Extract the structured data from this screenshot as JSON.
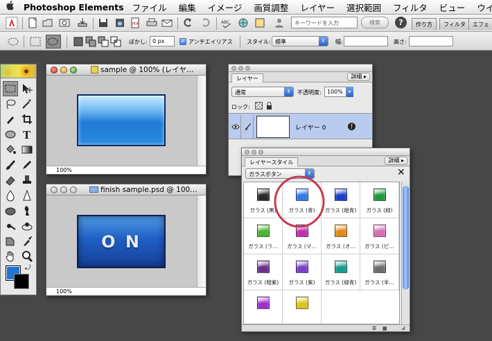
{
  "menubar": {
    "app_name": "Photoshop Elements",
    "menus": [
      "ファイル",
      "編集",
      "イメージ",
      "画質調整",
      "レイヤー",
      "選択範囲",
      "フィルタ",
      "ビュー",
      "ウイ"
    ]
  },
  "toolbar": {
    "search_placeholder": "キーワードを入力",
    "search_button": "検索",
    "help_label": "?",
    "palette_tabs": [
      "作り方",
      "フィルタ",
      "エフェ"
    ]
  },
  "options_bar": {
    "feather_label": "ぼかし:",
    "feather_value": "0 px",
    "antialias_label": "アンチエイリアス",
    "antialias_checked": true,
    "style_label": "スタイル:",
    "style_value": "標準",
    "width_label": "幅:",
    "height_label": "高さ:"
  },
  "windows": {
    "sample": {
      "title": "sample @ 100% (レイヤ…",
      "zoom": "100%"
    },
    "finish": {
      "title": "finish sample.psd @ 100…",
      "zoom": "100%",
      "button_text": "O N"
    }
  },
  "layers_panel": {
    "tab": "レイヤー",
    "more": "詳細 ▸",
    "blend_mode": "通常",
    "opacity_label": "不透明度:",
    "opacity_value": "100%",
    "lock_label": "ロック:",
    "layer_name": "レイヤー 0"
  },
  "styles_panel": {
    "tab": "レイヤースタイル",
    "more": "詳細 ▸",
    "category": "ガラスボタン",
    "close_label": "✕",
    "selected_index": 1,
    "items": [
      {
        "label": "ガラス (黒)",
        "color": "#2a2a2a"
      },
      {
        "label": "ガラス (青)",
        "color": "#2f7be0"
      },
      {
        "label": "ガラス (紺青)",
        "color": "#1c3fc7"
      },
      {
        "label": "ガラス (緑)",
        "color": "#1f9a3d"
      },
      {
        "label": "ガラス (ラ…",
        "color": "#46b52f"
      },
      {
        "label": "ガラス (マ…",
        "color": "#c02fb0"
      },
      {
        "label": "ガラス (オ…",
        "color": "#e08a18"
      },
      {
        "label": "ガラス (ピ…",
        "color": "#d66fb4"
      },
      {
        "label": "ガラス (暗紫)",
        "color": "#6a2f8a"
      },
      {
        "label": "ガラス (紫)",
        "color": "#7a3fc5"
      },
      {
        "label": "ガラス (緑青)",
        "color": "#159b8c"
      },
      {
        "label": "ガラス (半…",
        "color": "#6d6d6d"
      },
      {
        "label": "",
        "color": "#a02fd0"
      },
      {
        "label": "",
        "color": "#d8c81b"
      }
    ]
  },
  "colors": {
    "foreground": "#1f73d9",
    "background": "#000000",
    "highlight_circle": "#c43a52"
  }
}
